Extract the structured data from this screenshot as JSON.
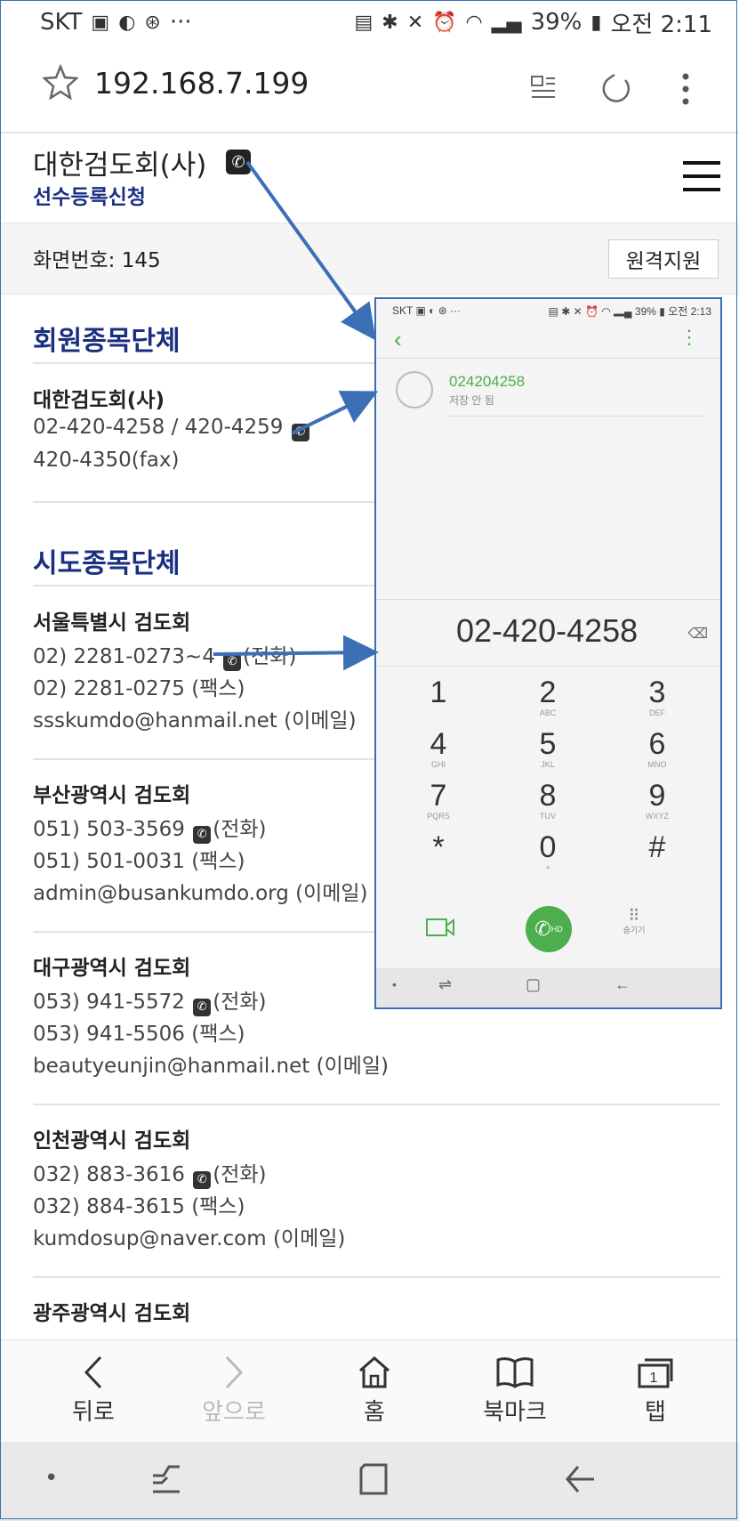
{
  "status_bar": {
    "carrier": "SKT",
    "more": "···",
    "battery": "39%",
    "time": "오전 2:11"
  },
  "url_bar": {
    "url": "192.168.7.199"
  },
  "site": {
    "name": "대한검도회(사)",
    "subtitle": "선수등록신청",
    "screen_number": "화면번호: 145",
    "remote_button": "원격지원"
  },
  "sections": [
    {
      "title": "회원종목단체",
      "orgs": [
        {
          "name": "대한검도회(사)",
          "lines": [
            {
              "text": "02-420-4258 / 420-4259",
              "phone": true,
              "suffix": ""
            },
            {
              "text": "420-4350(fax)",
              "phone": false,
              "suffix": ""
            }
          ]
        }
      ]
    },
    {
      "title": "시도종목단체",
      "orgs": [
        {
          "name": "서울특별시 검도회",
          "lines": [
            {
              "text": "02) 2281-0273~4",
              "phone": true,
              "suffix": "(전화)"
            },
            {
              "text": "02) 2281-0275 (팩스)",
              "phone": false,
              "suffix": ""
            },
            {
              "text": "ssskumdo@hanmail.net (이메일)",
              "phone": false,
              "suffix": ""
            }
          ]
        },
        {
          "name": "부산광역시 검도회",
          "lines": [
            {
              "text": "051) 503-3569",
              "phone": true,
              "suffix": "(전화)"
            },
            {
              "text": "051) 501-0031 (팩스)",
              "phone": false,
              "suffix": ""
            },
            {
              "text": "admin@busankumdo.org (이메일)",
              "phone": false,
              "suffix": ""
            }
          ]
        },
        {
          "name": "대구광역시 검도회",
          "lines": [
            {
              "text": "053) 941-5572",
              "phone": true,
              "suffix": "(전화)"
            },
            {
              "text": "053) 941-5506 (팩스)",
              "phone": false,
              "suffix": ""
            },
            {
              "text": "beautyeunjin@hanmail.net (이메일)",
              "phone": false,
              "suffix": ""
            }
          ]
        },
        {
          "name": "인천광역시 검도회",
          "lines": [
            {
              "text": "032) 883-3616",
              "phone": true,
              "suffix": "(전화)"
            },
            {
              "text": "032) 884-3615 (팩스)",
              "phone": false,
              "suffix": ""
            },
            {
              "text": "kumdosup@naver.com (이메일)",
              "phone": false,
              "suffix": ""
            }
          ]
        },
        {
          "name": "광주광역시 검도회",
          "lines": []
        }
      ]
    }
  ],
  "browser_nav": {
    "back": "뒤로",
    "forward": "앞으로",
    "home": "홈",
    "bookmarks": "북마크",
    "tabs": "탭",
    "tab_count": "1"
  },
  "dialer": {
    "status_carrier": "SKT",
    "status_more": "···",
    "status_battery": "39%",
    "status_time": "오전 2:13",
    "contact_number": "024204258",
    "contact_sub": "저장 안 됨",
    "dialed": "02-420-4258",
    "keys": [
      {
        "d": "1",
        "s": ""
      },
      {
        "d": "2",
        "s": "ABC"
      },
      {
        "d": "3",
        "s": "DEF"
      },
      {
        "d": "4",
        "s": "GHI"
      },
      {
        "d": "5",
        "s": "JKL"
      },
      {
        "d": "6",
        "s": "MNO"
      },
      {
        "d": "7",
        "s": "PQRS"
      },
      {
        "d": "8",
        "s": "TUV"
      },
      {
        "d": "9",
        "s": "WXYZ"
      },
      {
        "d": "*",
        "s": ""
      },
      {
        "d": "0",
        "s": "+"
      },
      {
        "d": "#",
        "s": ""
      }
    ],
    "hd_label": "HD",
    "hide_label": "숨기기"
  },
  "colors": {
    "accent_blue": "#1a2f80",
    "annotation_arrow": "#3b6fb6",
    "dialer_green": "#4cae4c"
  }
}
